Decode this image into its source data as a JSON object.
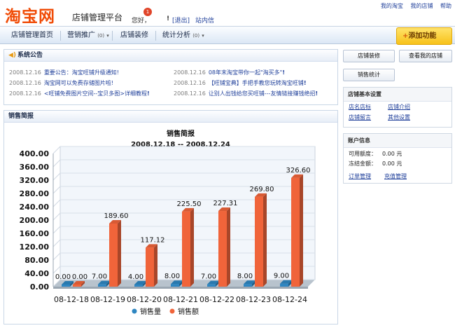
{
  "header": {
    "logo": "淘宝网",
    "platform": "店铺管理平台",
    "greeting": "您好，",
    "badge": "1",
    "exclaim": "!",
    "logout": "[退出]",
    "inbox": "站内信",
    "top_links": [
      "我的淘宝",
      "我的店铺",
      "帮助"
    ]
  },
  "nav": {
    "items": [
      {
        "label": "店铺管理首页",
        "count": ""
      },
      {
        "label": "营销推广",
        "count": "(0)"
      },
      {
        "label": "店铺装修",
        "count": ""
      },
      {
        "label": "统计分析",
        "count": "(0)"
      }
    ],
    "add_button": "添加功能",
    "add_plus": "+"
  },
  "announcements": {
    "title": "系统公告",
    "items": [
      {
        "date": "2008.12.16",
        "text": "重要公告：淘宝旺铺升级通知!",
        "ex": ""
      },
      {
        "date": "2008.12.16",
        "text": "08年末淘宝带你一起\"淘买多\"",
        "ex": "!"
      },
      {
        "date": "2008.12.16",
        "text": "淘宝网可以免费存储图片啦!",
        "ex": ""
      },
      {
        "date": "2008.12.16",
        "text": "【旺铺宝典】手把手教您玩转淘宝旺铺",
        "ex": "!"
      },
      {
        "date": "2008.12.16",
        "text": "<旺铺免费图片空间--宝贝多图>详细教程",
        "ex": "!"
      },
      {
        "date": "2008.12.16",
        "text": "让别人出钱给您买旺铺---友情链接赚钱绝招",
        "ex": "!"
      }
    ]
  },
  "sales": {
    "panel_title": "销售简报"
  },
  "right": {
    "buttons": [
      "店铺装修",
      "查看我的店铺",
      "销售统计"
    ],
    "settings": {
      "title": "店铺基本设置",
      "links": [
        "店名店标",
        "店铺介绍",
        "店铺留言",
        "其他设置"
      ]
    },
    "account": {
      "title": "账户信息",
      "available_label": "可用额度：",
      "available_value": "0.00 元",
      "frozen_label": "冻结金额：",
      "frozen_value": "0.00 元",
      "links": [
        "订单管理",
        "充值管理"
      ]
    }
  },
  "chart_data": {
    "type": "bar",
    "title": "销售简报",
    "subtitle": "2008.12.18 -- 2008.12.24",
    "categories": [
      "08-12-18",
      "08-12-19",
      "08-12-20",
      "08-12-21",
      "08-12-22",
      "08-12-23",
      "08-12-24"
    ],
    "series": [
      {
        "name": "销售量",
        "color": "#2e86c1",
        "values": [
          0,
          7,
          4,
          8,
          7,
          8,
          9
        ],
        "labels": [
          "0.00",
          "7.00",
          "4.00",
          "8.00",
          "7.00",
          "8.00",
          "9.00"
        ]
      },
      {
        "name": "销售额",
        "color": "#f0643a",
        "values": [
          0,
          189.6,
          117.12,
          225.5,
          227.31,
          269.8,
          326.6
        ],
        "labels": [
          "0.00",
          "189.60",
          "117.12",
          "225.50",
          "227.31",
          "269.80",
          "326.60"
        ]
      }
    ],
    "ylim": [
      0,
      400
    ],
    "yticks": [
      "400.00",
      "360.00",
      "320.00",
      "280.00",
      "240.00",
      "200.00",
      "160.00",
      "120.00",
      "80.00",
      "40.00",
      "0.00"
    ],
    "legend_position": "bottom",
    "grid": true
  }
}
